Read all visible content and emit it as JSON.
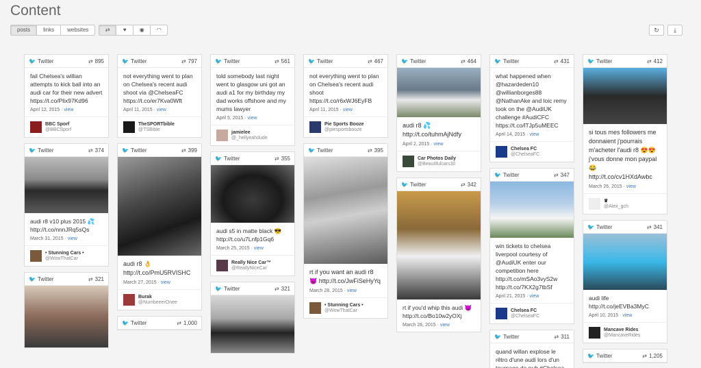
{
  "page_title": "Content",
  "filters": {
    "posts": "posts",
    "links": "links",
    "websites": "websites"
  },
  "icon_buttons": [
    "retweet-icon",
    "heart-icon",
    "eye-icon",
    "wifi-icon"
  ],
  "icon_glyphs": {
    "retweet": "⇄",
    "heart": "♥",
    "eye": "◉",
    "wifi": "◠",
    "refresh": "↻",
    "download": "⤓",
    "twitter": "🐦",
    "rt": "⇄"
  },
  "network": "Twitter",
  "columns": [
    [
      {
        "count": "895",
        "text": "fail Chelsea's willian attempts to kick ball into an audi car for their new advert https://t.co/Plix97Kd96",
        "date": "April 12, 2015",
        "view": "view",
        "user": "BBC Sporf",
        "handle": "@BBCSporf",
        "avatar": "#8a1e1e"
      },
      {
        "count": "374",
        "photo": "p1",
        "text": "audi r8 v10 plus 2015 💦 http://t.co/nnnJRq5sQs",
        "date": "March 31, 2015",
        "view": "view",
        "user": "• Stunning Cars •",
        "handle": "@WowThatCar",
        "avatar": "#7a5a3a"
      },
      {
        "count": "321",
        "photo": "p2"
      }
    ],
    [
      {
        "count": "797",
        "text": "not everything went to plan on Chelsea's recent audi shoot via @ChelseaFC https://t.co/er7Kva0Wft",
        "date": "April 11, 2015",
        "view": "view",
        "user": "TheSPORTbible",
        "handle": "@TSBible",
        "avatar": "#1a1a1a"
      },
      {
        "count": "399",
        "photo": "p3",
        "text": "audi r8 👌 http://t.co/PmU5RVISHC",
        "big": true,
        "date": "March 27, 2015",
        "view": "view",
        "user": "Burak",
        "handle": "@NumbeeerOnee",
        "avatar": "#9a3a3a"
      },
      {
        "count": "1,000"
      }
    ],
    [
      {
        "count": "561",
        "text": "told somebody last night went to glasgow uni got an audi a1 for my birthday my dad works offshore and my mums lawyer",
        "date": "April 5, 2015",
        "view": "view",
        "user": "jamielee",
        "handle": "@_hellyeahdude",
        "avatar": "#c7a9a0"
      },
      {
        "count": "355",
        "photo": "p4",
        "text": "audi s5 in matte black 😎 http://t.co/u7Lnfp1Gq6",
        "date": "March 25, 2015",
        "view": "view",
        "user": "Really Nice Car™",
        "handle": "@ReallyNiceCar",
        "avatar": "#5a3a4a"
      },
      {
        "count": "321",
        "photo": "p5"
      }
    ],
    [
      {
        "count": "467",
        "text": "not everything went to plan on Chelsea's recent audi shoot https://t.co/r6xWJ6EyFB",
        "date": "April 11, 2015",
        "view": "view",
        "user": "Pie Sports Booze",
        "handle": "@piesportsbooze",
        "avatar": "#2a3a6a"
      },
      {
        "count": "395",
        "photo": "p6",
        "text": "rt if you want an audi r8 😈 http://t.co/JwFiSeHyYq",
        "big": true,
        "date": "March 28, 2015",
        "view": "view",
        "user": "• Stunning Cars •",
        "handle": "@WowThatCar",
        "avatar": "#7a5a3a"
      }
    ],
    [
      {
        "count": "464",
        "photo": "p7",
        "text": "audi r8 💦 http://t.co/tuhmAjNdfy",
        "big": true,
        "date": "April 2, 2015",
        "view": "view",
        "user": "Car Photos Daily",
        "handle": "@Beautifulcars30",
        "avatar": "#3a4a3a"
      },
      {
        "count": "342",
        "photo": "p8",
        "text": "rt if you'd whip this audi 😈 http://t.co/Bo10w2yOXj",
        "date": "March 26, 2015",
        "view": "view"
      }
    ],
    [
      {
        "count": "431",
        "text": "what happened when @hazardeden10 @willianborges88 @NathanAke and loic remy took on the @AudiUK challenge #AudiCFC https://t.co/lTJp5uMEEC",
        "date": "April 14, 2015",
        "view": "view",
        "user": "Chelsea FC",
        "handle": "@ChelseaFC",
        "avatar": "#1a3a8a"
      },
      {
        "count": "347",
        "photo": "p9",
        "text": "win tickets to chelsea liverpool courtesy of @AudiUK enter our competition here http://t.co/mSAo3vyS2w http://t.co/7KX2g7tbSf",
        "date": "April 21, 2015",
        "view": "view",
        "user": "Chelsea FC",
        "handle": "@ChelseaFC",
        "avatar": "#1a3a8a"
      },
      {
        "count": "311",
        "text": "quand willan explose le rêtro d'une audi lors d'un tournage de pub #Chelsea"
      }
    ],
    [
      {
        "count": "412",
        "photo": "p10",
        "text": "si tous mes followers me donnaient j'pourrais m'acheter l'audi r8 😍😍 j'vous donne mon paypal 😂 http://t.co/cv1HXdAwbc",
        "big": true,
        "date": "March 26, 2015",
        "view": "view",
        "user": "♛",
        "handle": "@Alex_gch",
        "avatar": "#eeeeee"
      },
      {
        "count": "341",
        "photo": "p11",
        "text": "audi life http://t.co/jeEVBa3MyC",
        "date": "April 10, 2015",
        "view": "view",
        "user": "Mancave Rides",
        "handle": "@MancaveRides",
        "avatar": "#222222"
      },
      {
        "count": "1,205"
      }
    ]
  ]
}
